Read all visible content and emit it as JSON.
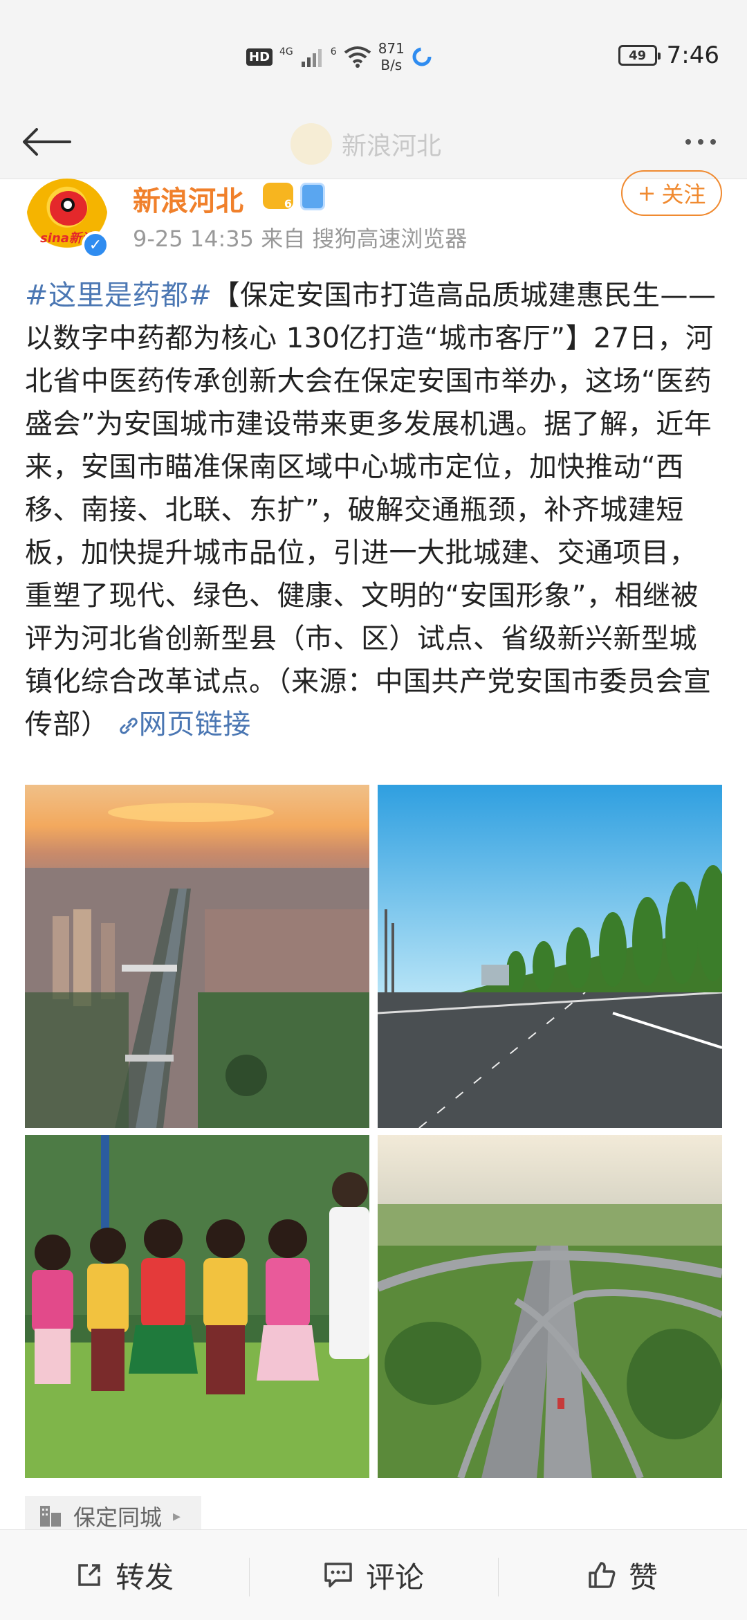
{
  "status_bar": {
    "hd": "HD",
    "network": "4G",
    "network2": "6",
    "speed_value": "871",
    "speed_unit": "B/s",
    "battery": "49",
    "time": "7:46"
  },
  "nav": {
    "title": "新浪河北"
  },
  "post": {
    "author": "新浪河北",
    "meta": "9-25 14:35  来自 搜狗高速浏览器",
    "follow_label": "关注",
    "follow_icon": "plus-icon",
    "avatar_text": "sina新浪",
    "hashtag": "#这里是药都#",
    "body": "【保定安国市打造高品质城建惠民生—— 以数字中药都为核心 130亿打造“城市客厅”】27日，河北省中医药传承创新大会在保定安国市举办，这场“医药盛会”为安国城市建设带来更多发展机遇。据了解，近年来，安国市瞄准保南区域中心城市定位，加快推动“西移、南接、北联、东扩”，破解交通瓶颈，补齐城建短板，加快提升城市品位，引进一大批城建、交通项目，重塑了现代、绿色、健康、文明的“安国形象”，相继被评为河北省创新型县（市、区）试点、省级新兴新型城镇化综合改革试点。（来源：中国共产党安国市委员会宣传部）",
    "link_label": "网页链接",
    "location": "保定同城"
  },
  "actions": {
    "repost": "转发",
    "comment": "评论",
    "like": "赞"
  },
  "colors": {
    "accent_orange": "#f0802b",
    "link_blue": "#4b77b3"
  }
}
